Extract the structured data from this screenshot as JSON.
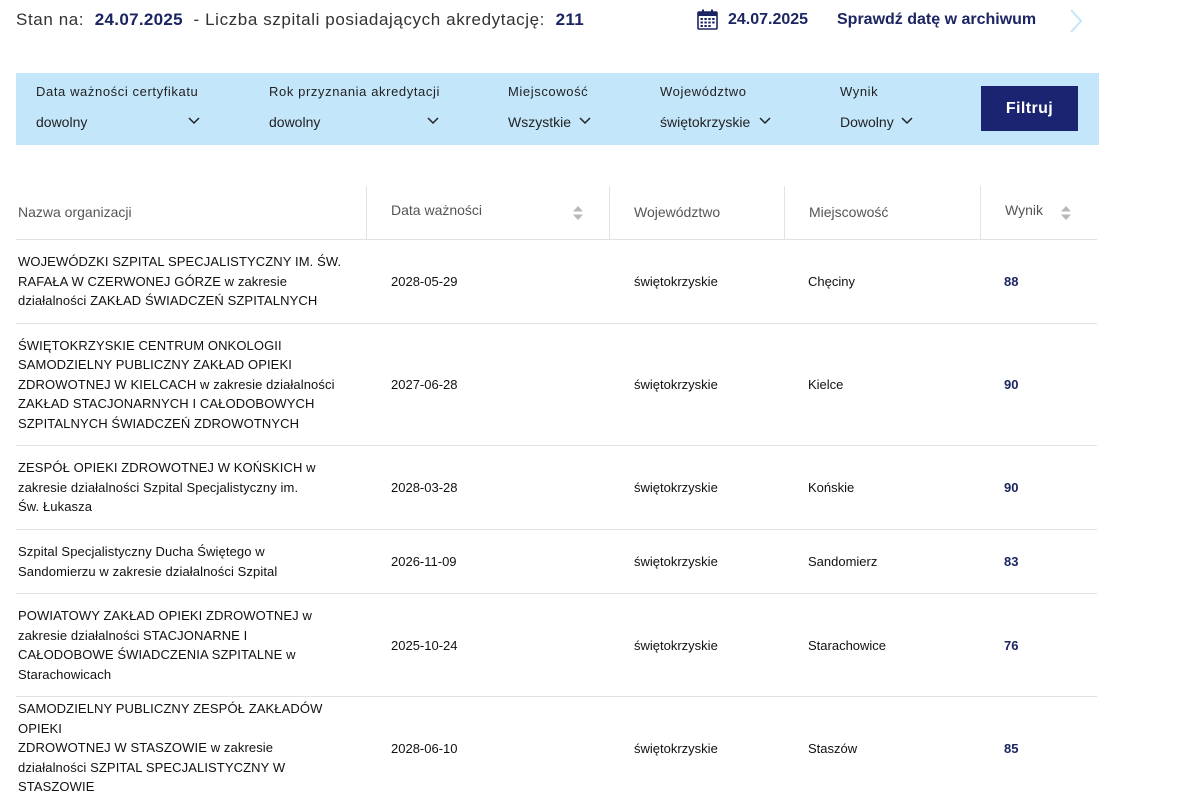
{
  "header": {
    "status_prefix": "Stan na:",
    "status_date": "24.07.2025",
    "status_middle": "- Liczba szpitali posiadających akredytację:",
    "hospital_count": "211",
    "selected_date": "24.07.2025",
    "archive_link": "Sprawdź datę w archiwum",
    "calendar_icon": "calendar-icon",
    "next_icon": "chevron-right-icon"
  },
  "filters": {
    "items": [
      {
        "label": "Data ważności certyfikatu",
        "value": "dowolny"
      },
      {
        "label": "Rok przyznania akredytacji",
        "value": "dowolny"
      },
      {
        "label": "Miejscowość",
        "value": "Wszystkie"
      },
      {
        "label": "Województwo",
        "value": "świętokrzyskie"
      },
      {
        "label": "Wynik",
        "value": "Dowolny"
      }
    ],
    "button_label": "Filtruj",
    "background_color": "#c4e6fb",
    "button_color": "#1b2470"
  },
  "table": {
    "columns": [
      "Nazwa organizacji",
      "Data ważności",
      "Województwo",
      "Miejscowość",
      "Wynik"
    ],
    "rows": [
      {
        "name_lines": [
          "WOJEWÓDZKI SZPITAL SPECJALISTYCZNY IM. ŚW.",
          "RAFAŁA W CZERWONEJ GÓRZE w zakresie",
          "działalności ZAKŁAD ŚWIADCZEŃ SZPITALNYCH"
        ],
        "date": "2028-05-29",
        "voivodeship": "świętokrzyskie",
        "city": "Chęciny",
        "score": "88"
      },
      {
        "name_lines": [
          "ŚWIĘTOKRZYSKIE CENTRUM ONKOLOGII",
          "SAMODZIELNY PUBLICZNY ZAKŁAD OPIEKI",
          "ZDROWOTNEJ W KIELCACH w zakresie działalności",
          "ZAKŁAD STACJONARNYCH I CAŁODOBOWYCH",
          "SZPITALNYCH ŚWIADCZEŃ ZDROWOTNYCH"
        ],
        "date": "2027-06-28",
        "voivodeship": "świętokrzyskie",
        "city": "Kielce",
        "score": "90"
      },
      {
        "name_lines": [
          "ZESPÓŁ OPIEKI ZDROWOTNEJ W KOŃSKICH w",
          "zakresie działalności Szpital Specjalistyczny im.",
          "Św. Łukasza"
        ],
        "date": "2028-03-28",
        "voivodeship": "świętokrzyskie",
        "city": "Końskie",
        "score": "90"
      },
      {
        "name_lines": [
          "Szpital Specjalistyczny Ducha Świętego w",
          "Sandomierzu w zakresie działalności Szpital"
        ],
        "date": "2026-11-09",
        "voivodeship": "świętokrzyskie",
        "city": "Sandomierz",
        "score": "83"
      },
      {
        "name_lines": [
          "POWIATOWY ZAKŁAD OPIEKI ZDROWOTNEJ w",
          "zakresie działalności STACJONARNE I",
          "CAŁODOBOWE ŚWIADCZENIA SZPITALNE w",
          "Starachowicach"
        ],
        "date": "2025-10-24",
        "voivodeship": "świętokrzyskie",
        "city": "Starachowice",
        "score": "76"
      },
      {
        "name_lines": [
          "SAMODZIELNY PUBLICZNY ZESPÓŁ ZAKŁADÓW OPIEKI",
          "ZDROWOTNEJ W STASZOWIE w zakresie",
          "działalności SZPITAL SPECJALISTYCZNY W",
          "STASZOWIE"
        ],
        "date": "2028-06-10",
        "voivodeship": "świętokrzyskie",
        "city": "Staszów",
        "score": "85"
      }
    ],
    "score_color": "#1b2561"
  }
}
